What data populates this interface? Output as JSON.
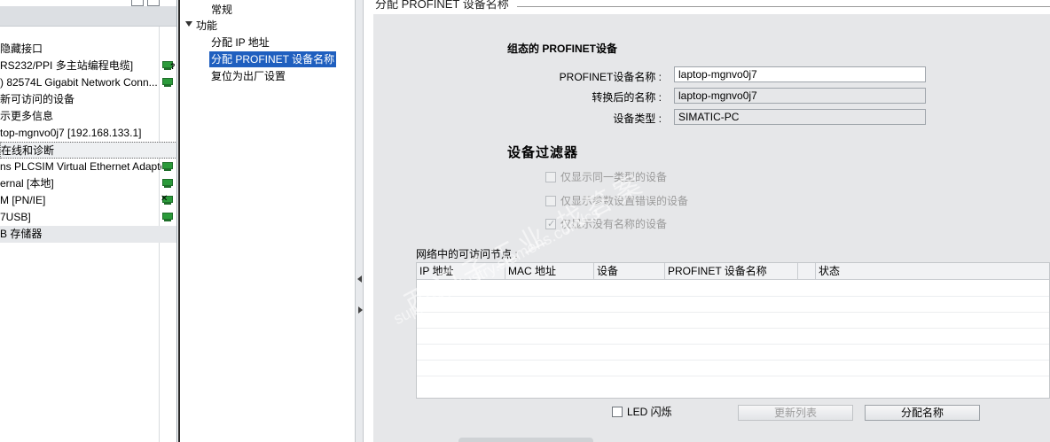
{
  "left_tree": {
    "items": [
      {
        "label": "隐藏接口",
        "shaded": false,
        "icon": null
      },
      {
        "label": "RS232/PPI 多主站编程电缆]",
        "shaded": false,
        "icon": "network-unknown-icon"
      },
      {
        "label": ") 82574L Gigabit Network Conn...",
        "shaded": false,
        "icon": "network-icon"
      },
      {
        "label": "新可访问的设备",
        "shaded": false,
        "icon": null
      },
      {
        "label": "示更多信息",
        "shaded": false,
        "icon": null
      },
      {
        "label": "top-mgnvo0j7 [192.168.133.1]",
        "shaded": false,
        "icon": null
      },
      {
        "label": "在线和诊断",
        "shaded": true,
        "icon": null
      },
      {
        "label": "ns PLCSIM Virtual Ethernet Adapter",
        "shaded": false,
        "icon": "network-icon"
      },
      {
        "label": "ernal [本地]",
        "shaded": false,
        "icon": "network-icon"
      },
      {
        "label": "M [PN/IE]",
        "shaded": false,
        "icon": "network-error-icon"
      },
      {
        "label": "7USB]",
        "shaded": false,
        "icon": "network-icon"
      },
      {
        "label": "B 存储器",
        "shaded": true,
        "icon": null
      }
    ]
  },
  "nav": {
    "general": "常规",
    "functions": "功能",
    "assign_ip": "分配 IP 地址",
    "assign_name": "分配 PROFINET 设备名称",
    "reset": "复位为出厂设置"
  },
  "section": {
    "title": "分配 PROFINET 设备名称"
  },
  "configured": {
    "heading": "组态的 PROFINET设备",
    "name_label": "PROFINET设备名称 :",
    "name_value": "laptop-mgnvo0j7",
    "converted_label": "转换后的名称 :",
    "converted_value": "laptop-mgnvo0j7",
    "type_label": "设备类型 :",
    "type_value": "SIMATIC-PC"
  },
  "filter": {
    "heading": "设备过滤器",
    "same_type": "仅显示同一类型的设备",
    "wrong_params": "仅显示参数设置错误的设备",
    "no_name": "仅显示没有名称的设备"
  },
  "nodes": {
    "label": "网络中的可访问节点 :",
    "columns": [
      "IP 地址",
      "MAC 地址",
      "设备",
      "PROFINET 设备名称",
      "",
      "状态"
    ]
  },
  "buttons": {
    "led": "LED 闪烁",
    "refresh": "更新列表",
    "assign": "分配名称"
  },
  "watermark": {
    "line1": "西门子工业 找答案",
    "line2": "support.industry.siemens.com/cs"
  }
}
